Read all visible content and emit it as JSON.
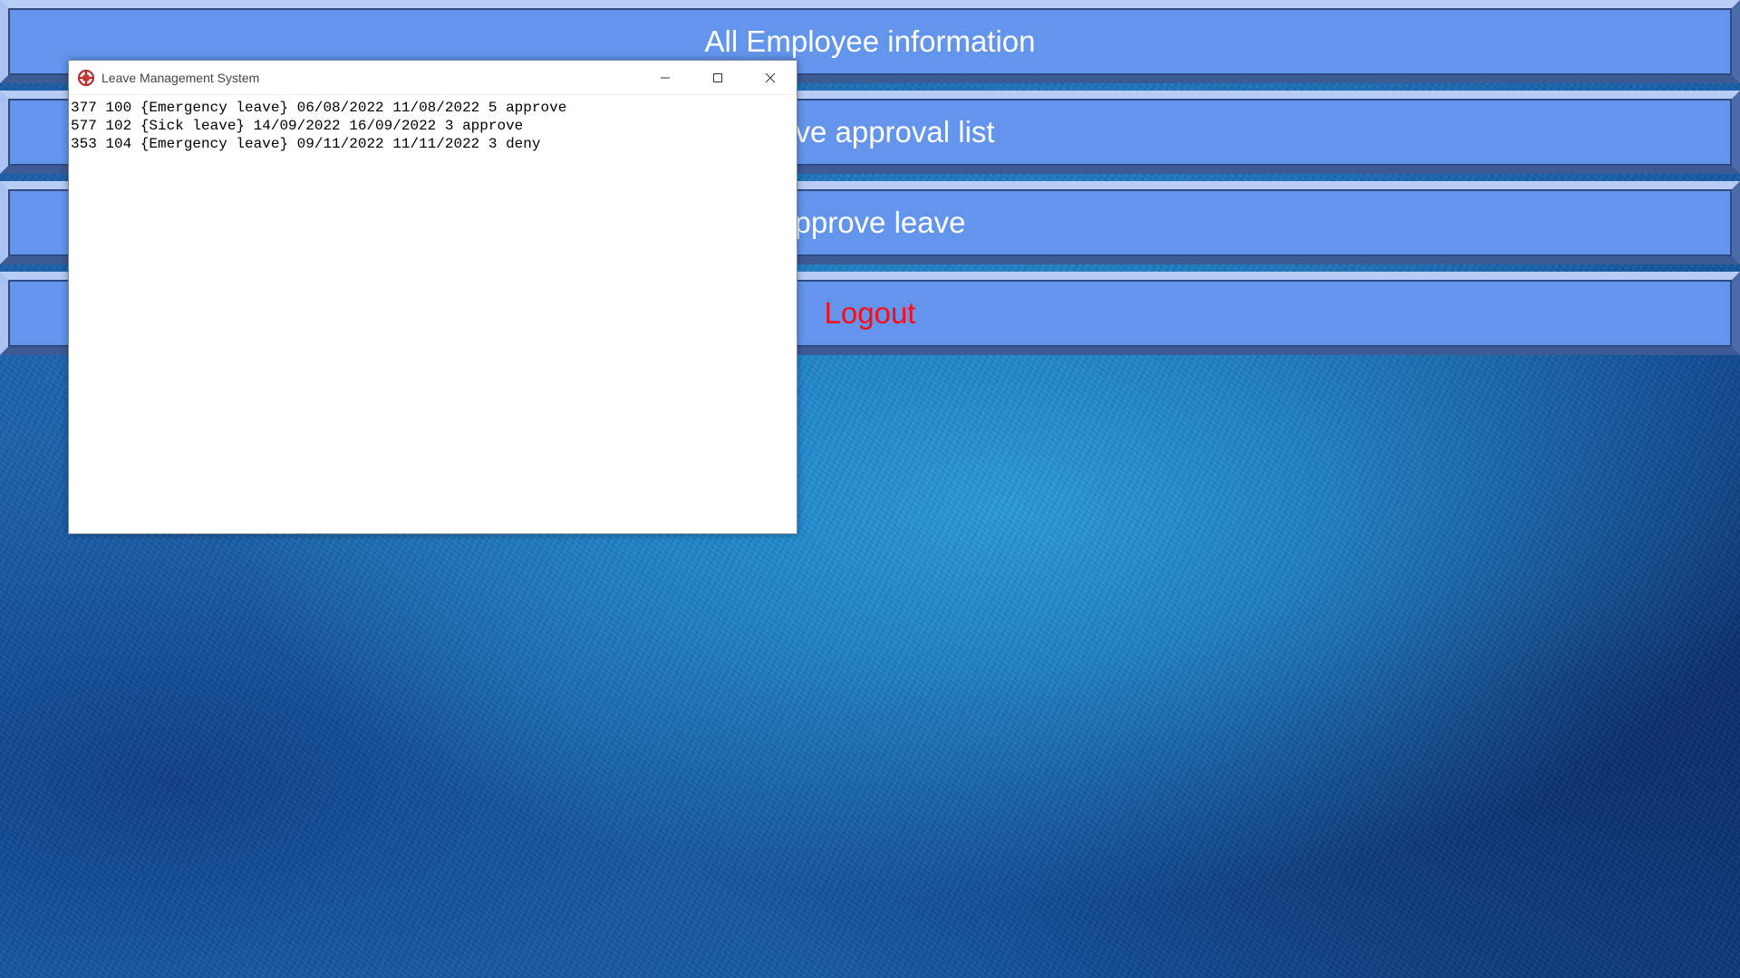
{
  "menu": {
    "all_employee_info": "All Employee information",
    "leave_approval_list": "Leave approval list",
    "approve_leave": "Approve leave",
    "logout": "Logout"
  },
  "window": {
    "title": "Leave Management System",
    "records": [
      "377 100 {Emergency leave} 06/08/2022 11/08/2022 5 approve",
      "577 102 {Sick leave} 14/09/2022 16/09/2022 3 approve",
      "353 104 {Emergency leave} 09/11/2022 11/11/2022 3 deny"
    ]
  },
  "colors": {
    "button_face": "#6495ed",
    "logout_text": "#ff0a14",
    "button_text": "#ffffff"
  },
  "icons": {
    "app": "app-feather-icon",
    "minimize": "minimize-icon",
    "maximize": "maximize-icon",
    "close": "close-icon"
  }
}
